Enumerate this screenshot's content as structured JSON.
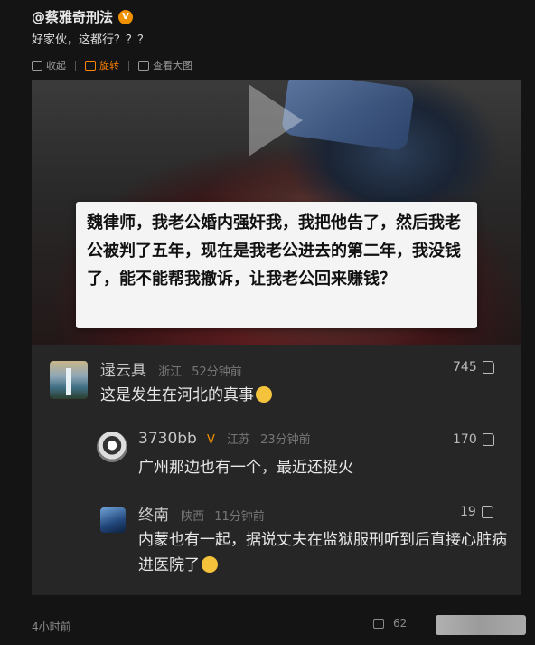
{
  "post": {
    "author": "@蔡雅奇刑法",
    "verified_badge": "V",
    "text": "好家伙，这都行？？？",
    "toolbar": {
      "collect": "收起",
      "rotate": "旋转",
      "view_large": "查看大图"
    }
  },
  "image_caption": "魏律师，我老公婚内强奸我，我把他告了，然后我老公被判了五年，现在是我老公进去的第二年，我没钱了，能不能帮我撤诉，让我老公回来赚钱？",
  "comments": [
    {
      "name": "逯云具",
      "location": "浙江",
      "time": "52分钟前",
      "likes": "745",
      "text": "这是发生在河北的真事"
    },
    {
      "name": "3730bb",
      "location": "江苏",
      "time": "23分钟前",
      "likes": "170",
      "text": "广州那边也有一个，最近还挺火"
    },
    {
      "name": "终南",
      "location": "陕西",
      "time": "11分钟前",
      "likes": "19",
      "text": "内蒙也有一起，据说丈夫在监狱服刑听到后直接心脏病进医院了"
    }
  ],
  "footer": {
    "time": "4小时前",
    "share_count": "62"
  },
  "colors": {
    "accent": "#ff8200",
    "verified": "#f29100",
    "background": "#141414"
  }
}
